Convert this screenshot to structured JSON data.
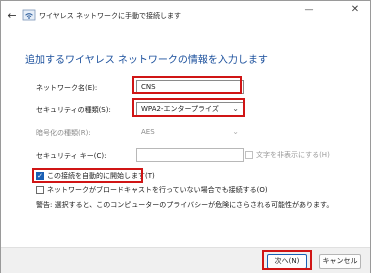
{
  "window": {
    "title": "ワイヤレス ネットワークに手動で接続します",
    "back_glyph": "←",
    "minimize_glyph": "—",
    "close_glyph": "✕"
  },
  "heading": "追加するワイヤレス ネットワークの情報を入力します",
  "form": {
    "network_name": {
      "label": "ネットワーク名(E):",
      "value": "CNS"
    },
    "security_type": {
      "label": "セキュリティの種類(S):",
      "value": "WPA2-エンタープライズ"
    },
    "encryption_type": {
      "label": "暗号化の種類(R):",
      "value": "AES"
    },
    "security_key": {
      "label": "セキュリティ キー(C):",
      "value": ""
    },
    "hide_chars": {
      "label": "文字を非表示にする(H)",
      "checked": false,
      "enabled": false
    }
  },
  "options": {
    "auto_connect": {
      "label": "この接続を自動的に開始します(T)",
      "checked": true
    },
    "connect_hidden": {
      "label": "ネットワークがブロードキャストを行っていない場合でも接続する(O)",
      "checked": false
    }
  },
  "warning": "警告: 選択すると、このコンピューターのプライバシーが危険にさらされる可能性があります。",
  "buttons": {
    "next": "次へ(N)",
    "cancel": "キャンセル"
  },
  "icons": {
    "wifi": "wifi-icon",
    "back": "back-arrow-icon",
    "check": "checkmark-icon",
    "dropdown": "chevron-down-icon"
  },
  "colors": {
    "highlight": "#d01515",
    "heading": "#1a4f9c",
    "accent": "#1a5fb4"
  }
}
